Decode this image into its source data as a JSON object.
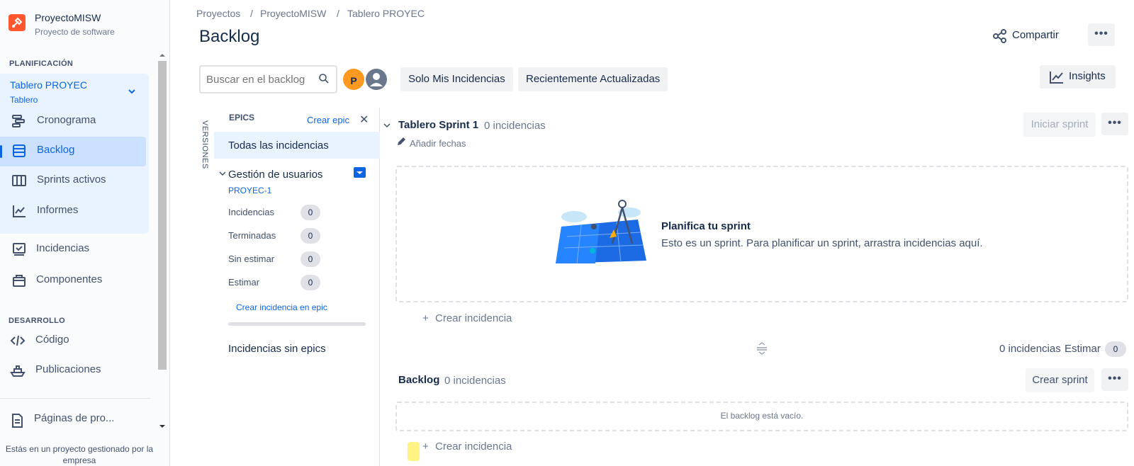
{
  "project": {
    "name": "ProyectoMISW",
    "type": "Proyecto de software"
  },
  "sidebar": {
    "section_planning": "PLANIFICACIÓN",
    "board": {
      "title": "Tablero PROYEC",
      "subtitle": "Tablero"
    },
    "planning_items": [
      {
        "label": "Cronograma",
        "icon": "timeline-icon"
      },
      {
        "label": "Backlog",
        "icon": "backlog-icon",
        "active": true
      },
      {
        "label": "Sprints activos",
        "icon": "board-columns-icon"
      },
      {
        "label": "Informes",
        "icon": "reports-chart-icon"
      }
    ],
    "other_items": [
      {
        "label": "Incidencias",
        "icon": "issues-icon"
      },
      {
        "label": "Componentes",
        "icon": "components-icon"
      }
    ],
    "section_dev": "DESARROLLO",
    "dev_items": [
      {
        "label": "Código",
        "icon": "code-icon"
      },
      {
        "label": "Publicaciones",
        "icon": "ship-icon"
      }
    ],
    "pages_item": {
      "label": "Páginas de pro...",
      "icon": "page-icon"
    },
    "footer": "Estás en un proyecto gestionado por la empresa"
  },
  "breadcrumb": [
    "Proyectos",
    "ProyectoMISW",
    "Tablero PROYEC"
  ],
  "breadcrumb_sep": "/",
  "page_title": "Backlog",
  "header": {
    "share_label": "Compartir",
    "more_label": "•••"
  },
  "toolbar": {
    "search_placeholder": "Buscar en el backlog",
    "avatar_initial": "P",
    "filters": [
      "Solo Mis Incidencias",
      "Recientemente Actualizadas"
    ],
    "insights_label": "Insights"
  },
  "versions_tab": "VERSIONES",
  "epics": {
    "title": "EPICS",
    "create_label": "Crear epic",
    "close_label": "✕",
    "all_issues": "Todas las incidencias",
    "epic": {
      "name": "Gestión de usuarios",
      "key": "PROYEC-1",
      "stats": [
        {
          "label": "Incidencias",
          "value": "0"
        },
        {
          "label": "Terminadas",
          "value": "0"
        },
        {
          "label": "Sin estimar",
          "value": "0"
        },
        {
          "label": "Estimar",
          "value": "0"
        }
      ],
      "create_in_epic": "Crear incidencia en epic",
      "progress": 0
    },
    "no_epic": "Incidencias sin epics"
  },
  "sprint": {
    "name": "Tablero Sprint 1",
    "count": "0 incidencias",
    "add_dates": "Añadir fechas",
    "start_label": "Iniciar sprint",
    "more_label": "•••",
    "empty_title": "Planifica tu sprint",
    "empty_desc": "Esto es un sprint. Para planificar un sprint, arrastra incidencias aquí.",
    "create_issue": "Crear incidencia",
    "plus": "+",
    "summary_count": "0 incidencias",
    "estimate_label": "Estimar",
    "estimate_value": "0"
  },
  "backlog": {
    "name": "Backlog",
    "count": "0 incidencias",
    "create_sprint": "Crear sprint",
    "more_label": "•••",
    "empty": "El backlog está vacío.",
    "create_issue": "Crear incidencia",
    "plus": "+"
  },
  "colors": {
    "accent": "#0c66e4",
    "selected_bg": "#e9f2ff",
    "active_nav_bg": "#cce0ff",
    "avatar": "#ff991f",
    "project_icon": "#ff5630"
  }
}
